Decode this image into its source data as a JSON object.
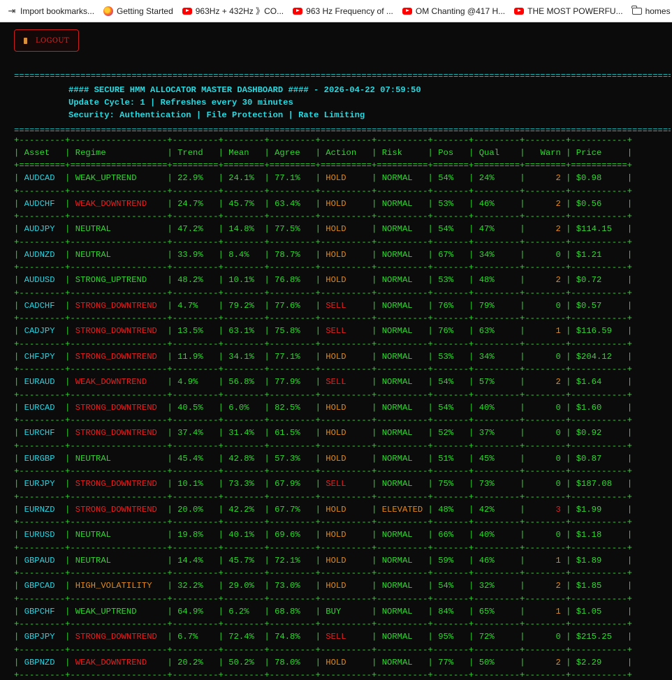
{
  "bookmarks": [
    {
      "label": "Import bookmarks...",
      "icon": "import-icon"
    },
    {
      "label": "Getting Started",
      "icon": "firefox-icon"
    },
    {
      "label": "963Hz + 432Hz 》CO...",
      "icon": "youtube-icon"
    },
    {
      "label": "963 Hz Frequency of ...",
      "icon": "youtube-icon"
    },
    {
      "label": "OM Chanting @417 H...",
      "icon": "youtube-icon"
    },
    {
      "label": "THE MOST POWERFU...",
      "icon": "youtube-icon"
    },
    {
      "label": "homes",
      "icon": "folder-icon"
    }
  ],
  "logout_label": "LOGOUT",
  "header": {
    "title": "#### SECURE HMM ALLOCATOR MASTER DASHBOARD #### - 2026-04-22 07:59:50",
    "cycle": "Update Cycle: 1 | Refreshes every 30 minutes",
    "security": "Security: Authentication | File Protection | Rate Limiting"
  },
  "columns": [
    "Asset",
    "Regime",
    "Trend",
    "Mean",
    "Agree",
    "Action",
    "Risk",
    "Pos",
    "Qual",
    "Warn",
    "Price"
  ],
  "rows": [
    {
      "asset": "AUDCAD",
      "regime": "WEAK_UPTREND",
      "trend": "22.9%",
      "mean": "24.1%",
      "agree": "77.1%",
      "action": "HOLD",
      "risk": "NORMAL",
      "pos": "54%",
      "qual": "24%",
      "warn": "2",
      "price": "$0.98"
    },
    {
      "asset": "AUDCHF",
      "regime": "WEAK_DOWNTREND",
      "trend": "24.7%",
      "mean": "45.7%",
      "agree": "63.4%",
      "action": "HOLD",
      "risk": "NORMAL",
      "pos": "53%",
      "qual": "46%",
      "warn": "2",
      "price": "$0.56"
    },
    {
      "asset": "AUDJPY",
      "regime": "NEUTRAL",
      "trend": "47.2%",
      "mean": "14.8%",
      "agree": "77.5%",
      "action": "HOLD",
      "risk": "NORMAL",
      "pos": "54%",
      "qual": "47%",
      "warn": "2",
      "price": "$114.15"
    },
    {
      "asset": "AUDNZD",
      "regime": "NEUTRAL",
      "trend": "33.9%",
      "mean": "8.4%",
      "agree": "78.7%",
      "action": "HOLD",
      "risk": "NORMAL",
      "pos": "67%",
      "qual": "34%",
      "warn": "0",
      "price": "$1.21"
    },
    {
      "asset": "AUDUSD",
      "regime": "STRONG_UPTREND",
      "trend": "48.2%",
      "mean": "10.1%",
      "agree": "76.8%",
      "action": "HOLD",
      "risk": "NORMAL",
      "pos": "53%",
      "qual": "48%",
      "warn": "2",
      "price": "$0.72"
    },
    {
      "asset": "CADCHF",
      "regime": "STRONG_DOWNTREND",
      "trend": "4.7%",
      "mean": "79.2%",
      "agree": "77.6%",
      "action": "SELL",
      "risk": "NORMAL",
      "pos": "76%",
      "qual": "79%",
      "warn": "0",
      "price": "$0.57"
    },
    {
      "asset": "CADJPY",
      "regime": "STRONG_DOWNTREND",
      "trend": "13.5%",
      "mean": "63.1%",
      "agree": "75.8%",
      "action": "SELL",
      "risk": "NORMAL",
      "pos": "76%",
      "qual": "63%",
      "warn": "1",
      "price": "$116.59"
    },
    {
      "asset": "CHFJPY",
      "regime": "STRONG_DOWNTREND",
      "trend": "11.9%",
      "mean": "34.1%",
      "agree": "77.1%",
      "action": "HOLD",
      "risk": "NORMAL",
      "pos": "53%",
      "qual": "34%",
      "warn": "0",
      "price": "$204.12"
    },
    {
      "asset": "EURAUD",
      "regime": "WEAK_DOWNTREND",
      "trend": "4.9%",
      "mean": "56.8%",
      "agree": "77.9%",
      "action": "SELL",
      "risk": "NORMAL",
      "pos": "54%",
      "qual": "57%",
      "warn": "2",
      "price": "$1.64"
    },
    {
      "asset": "EURCAD",
      "regime": "STRONG_DOWNTREND",
      "trend": "40.5%",
      "mean": "6.0%",
      "agree": "82.5%",
      "action": "HOLD",
      "risk": "NORMAL",
      "pos": "54%",
      "qual": "40%",
      "warn": "0",
      "price": "$1.60"
    },
    {
      "asset": "EURCHF",
      "regime": "STRONG_DOWNTREND",
      "trend": "37.4%",
      "mean": "31.4%",
      "agree": "61.5%",
      "action": "HOLD",
      "risk": "NORMAL",
      "pos": "52%",
      "qual": "37%",
      "warn": "0",
      "price": "$0.92"
    },
    {
      "asset": "EURGBP",
      "regime": "NEUTRAL",
      "trend": "45.4%",
      "mean": "42.8%",
      "agree": "57.3%",
      "action": "HOLD",
      "risk": "NORMAL",
      "pos": "51%",
      "qual": "45%",
      "warn": "0",
      "price": "$0.87"
    },
    {
      "asset": "EURJPY",
      "regime": "STRONG_DOWNTREND",
      "trend": "10.1%",
      "mean": "73.3%",
      "agree": "67.9%",
      "action": "SELL",
      "risk": "NORMAL",
      "pos": "75%",
      "qual": "73%",
      "warn": "0",
      "price": "$187.08"
    },
    {
      "asset": "EURNZD",
      "regime": "STRONG_DOWNTREND",
      "trend": "20.0%",
      "mean": "42.2%",
      "agree": "67.7%",
      "action": "HOLD",
      "risk": "ELEVATED",
      "pos": "48%",
      "qual": "42%",
      "warn": "3",
      "price": "$1.99"
    },
    {
      "asset": "EURUSD",
      "regime": "NEUTRAL",
      "trend": "19.8%",
      "mean": "40.1%",
      "agree": "69.6%",
      "action": "HOLD",
      "risk": "NORMAL",
      "pos": "66%",
      "qual": "40%",
      "warn": "0",
      "price": "$1.18"
    },
    {
      "asset": "GBPAUD",
      "regime": "NEUTRAL",
      "trend": "14.4%",
      "mean": "45.7%",
      "agree": "72.1%",
      "action": "HOLD",
      "risk": "NORMAL",
      "pos": "59%",
      "qual": "46%",
      "warn": "1",
      "price": "$1.89"
    },
    {
      "asset": "GBPCAD",
      "regime": "HIGH_VOLATILITY",
      "trend": "32.2%",
      "mean": "29.0%",
      "agree": "73.0%",
      "action": "HOLD",
      "risk": "NORMAL",
      "pos": "54%",
      "qual": "32%",
      "warn": "2",
      "price": "$1.85"
    },
    {
      "asset": "GBPCHF",
      "regime": "WEAK_UPTREND",
      "trend": "64.9%",
      "mean": "6.2%",
      "agree": "68.8%",
      "action": "BUY",
      "risk": "NORMAL",
      "pos": "84%",
      "qual": "65%",
      "warn": "1",
      "price": "$1.05"
    },
    {
      "asset": "GBPJPY",
      "regime": "STRONG_DOWNTREND",
      "trend": "6.7%",
      "mean": "72.4%",
      "agree": "74.8%",
      "action": "SELL",
      "risk": "NORMAL",
      "pos": "95%",
      "qual": "72%",
      "warn": "0",
      "price": "$215.25"
    },
    {
      "asset": "GBPNZD",
      "regime": "WEAK_DOWNTREND",
      "trend": "20.2%",
      "mean": "50.2%",
      "agree": "78.0%",
      "action": "HOLD",
      "risk": "NORMAL",
      "pos": "77%",
      "qual": "50%",
      "warn": "2",
      "price": "$2.29"
    }
  ]
}
